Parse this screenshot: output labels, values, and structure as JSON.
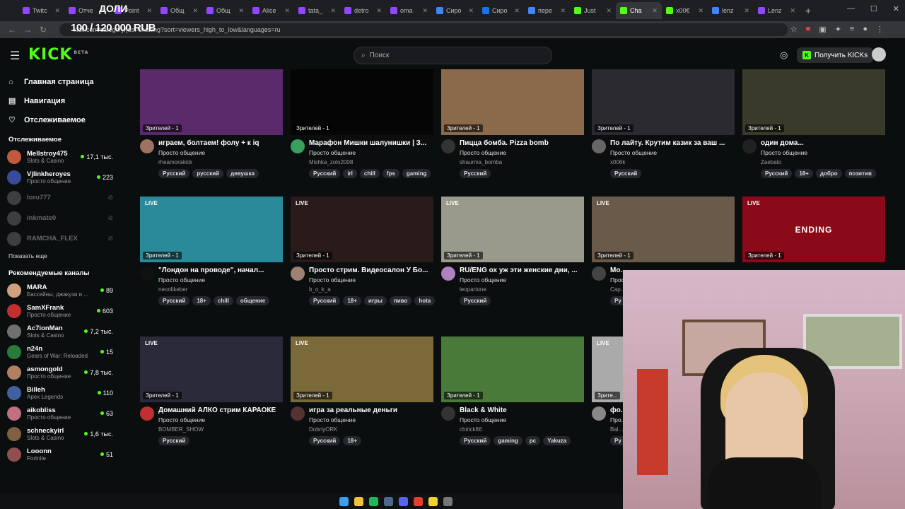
{
  "browser": {
    "tabs": [
      {
        "label": "Twitc",
        "color": "#9146ff"
      },
      {
        "label": "Отче",
        "color": "#9146ff"
      },
      {
        "label": "Point",
        "color": "#9146ff"
      },
      {
        "label": "Общ",
        "color": "#9146ff"
      },
      {
        "label": "Общ",
        "color": "#9146ff"
      },
      {
        "label": "Alice",
        "color": "#9146ff"
      },
      {
        "label": "tata_",
        "color": "#9146ff"
      },
      {
        "label": "detro",
        "color": "#9146ff"
      },
      {
        "label": "oma",
        "color": "#9146ff"
      },
      {
        "label": "Сиро",
        "color": "#4285f4"
      },
      {
        "label": "Сиро",
        "color": "#1a73e8"
      },
      {
        "label": "пере",
        "color": "#4285f4"
      },
      {
        "label": "Just",
        "color": "#53fc18"
      },
      {
        "label": "Сha",
        "color": "#53fc18"
      },
      {
        "label": "x00€",
        "color": "#53fc18"
      },
      {
        "label": "lenz",
        "color": "#4285f4"
      },
      {
        "label": "Lenz",
        "color": "#9146ff"
      }
    ],
    "active_tab_index": 13,
    "url": "kick.com/category/just-chatting?sort=viewers_high_to_low&languages=ru",
    "overlay_counter": "100 / 120 000 RUB",
    "overlay_label": "ДОЛИ"
  },
  "header": {
    "logo": "KICK",
    "logo_badge": "BETA",
    "search_placeholder": "Поиск",
    "get_kicks_label": "Получить KICKs"
  },
  "sidebar": {
    "nav": [
      {
        "label": "Главная страница",
        "icon": "home-icon",
        "glyph": "⌂"
      },
      {
        "label": "Навигация",
        "icon": "compass-icon",
        "glyph": "▤"
      },
      {
        "label": "Отслеживаемое",
        "icon": "heart-icon",
        "glyph": "♡"
      }
    ],
    "following_title": "Отслеживаемое",
    "following": [
      {
        "name": "Mellstroy475",
        "category": "Slots & Casino",
        "count": "17,1 тыс.",
        "online": true,
        "color": "#c05a3a"
      },
      {
        "name": "Vjlinkheroyes",
        "category": "Просто общение",
        "count": "223",
        "online": true,
        "color": "#3a4a9a"
      },
      {
        "name": "loru777",
        "category": "",
        "count": "",
        "online": false,
        "color": "#888"
      },
      {
        "name": "inkmate0",
        "category": "",
        "count": "",
        "online": false,
        "color": "#888"
      },
      {
        "name": "RAMCHA_FLEX",
        "category": "",
        "count": "",
        "online": false,
        "color": "#888"
      }
    ],
    "show_more": "Показать еще",
    "recommended_title": "Рекомендуемые каналы",
    "recommended": [
      {
        "name": "MARA",
        "category": "Бассейны, джакузи и ...",
        "count": "89",
        "color": "#d0a080"
      },
      {
        "name": "SamXFrank",
        "category": "Просто общение",
        "count": "603",
        "color": "#c03030"
      },
      {
        "name": "Ac7ionMan",
        "category": "Slots & Casino",
        "count": "7,2 тыс.",
        "color": "#707070"
      },
      {
        "name": "n24n",
        "category": "Gears of War: Reloaded",
        "count": "15",
        "color": "#2a7a3a"
      },
      {
        "name": "asmongold",
        "category": "Просто общение",
        "count": "7,8 тыс.",
        "color": "#b08060"
      },
      {
        "name": "Billeh",
        "category": "Apex Legends",
        "count": "110",
        "color": "#4060a0"
      },
      {
        "name": "aikobliss",
        "category": "Просто общение",
        "count": "63",
        "color": "#c07080"
      },
      {
        "name": "schneckyirl",
        "category": "Slots & Casino",
        "count": "1,6 тыс.",
        "color": "#806040"
      },
      {
        "name": "Looonn",
        "category": "Fortnite",
        "count": "51",
        "color": "#905050"
      }
    ]
  },
  "streams": [
    {
      "title": "играем, болтаем! фолу + к iq",
      "category": "Просто общение",
      "user": "rheamorakick",
      "viewers": "Зрителей - 1",
      "live": "",
      "tags": [
        "Русский",
        "русский",
        "девушка"
      ],
      "thumb": "#5a2a6a",
      "avatar": "#a07060"
    },
    {
      "title": "Марафон Мишки шалунишки | З...",
      "category": "Просто общение",
      "user": "Mishka_zolo2008",
      "viewers": "Зрителей - 1",
      "live": "",
      "tags": [
        "Русский",
        "irl",
        "chill",
        "fps",
        "gaming"
      ],
      "thumb": "#050505",
      "avatar": "#3aa060"
    },
    {
      "title": "Пицца бомба. Pizza bomb",
      "category": "Просто общение",
      "user": "shaurma_bomba",
      "viewers": "Зрителей - 1",
      "live": "",
      "tags": [
        "Русский"
      ],
      "thumb": "#8a6a4a",
      "avatar": "#333"
    },
    {
      "title": "По лайту. Крутим казик за ваш ...",
      "category": "Просто общение",
      "user": "x006k",
      "viewers": "Зрителей - 1",
      "live": "",
      "tags": [
        "Русский"
      ],
      "thumb": "#2a2a30",
      "avatar": "#666"
    },
    {
      "title": "один дома...",
      "category": "Просто общение",
      "user": "Zaebato",
      "viewers": "Зрителей - 1",
      "live": "",
      "tags": [
        "Русский",
        "18+",
        "добро",
        "позитив"
      ],
      "thumb": "#3a3a2a",
      "avatar": "#222"
    },
    {
      "title": "\"Лондон на проводе\", начал...",
      "category": "Просто общение",
      "user": "neonlikeber",
      "viewers": "Зрителей - 1",
      "live": "LIVE",
      "tags": [
        "Русский",
        "18+",
        "chill",
        "общение"
      ],
      "thumb": "#2a8a9a",
      "avatar": "#111"
    },
    {
      "title": "Просто стрим. Видеосалон У Бо...",
      "category": "Просто общение",
      "user": "b_o_k_a",
      "viewers": "Зрителей - 1",
      "live": "LIVE",
      "tags": [
        "Русский",
        "18+",
        "игры",
        "пиво",
        "hota"
      ],
      "thumb": "#2a1a1a",
      "avatar": "#a08070"
    },
    {
      "title": "RU/ENG ох уж эти женские дни, ...",
      "category": "Просто общение",
      "user": "leopartone",
      "viewers": "Зрителей - 1",
      "live": "LIVE",
      "tags": [
        "Русский"
      ],
      "thumb": "#9a9a8a",
      "avatar": "#b080c0"
    },
    {
      "title": "Мо...",
      "category": "Просто общение",
      "user": "Cap...",
      "viewers": "Зрителей - 1",
      "live": "LIVE",
      "tags": [
        "Ру"
      ],
      "thumb": "#6a5a4a",
      "avatar": "#444"
    },
    {
      "title": "",
      "category": "",
      "user": "",
      "viewers": "Зрителей - 1",
      "live": "LIVE",
      "tags": [],
      "thumb": "#8a0a1a",
      "avatar": "#333",
      "thumb_text": "ENDING"
    },
    {
      "title": "Домашний АЛКО стрим КАРАОКЕ",
      "category": "Просто общение",
      "user": "BOMBER_SHOW",
      "viewers": "Зрителей - 1",
      "live": "LIVE",
      "tags": [
        "Русский"
      ],
      "thumb": "#2a2a3a",
      "avatar": "#c03030"
    },
    {
      "title": "игра за реальные деньги",
      "category": "Просто общение",
      "user": "DobriyORK",
      "viewers": "Зрителей - 1",
      "live": "LIVE",
      "tags": [
        "Русский",
        "18+"
      ],
      "thumb": "#7a6a3a",
      "avatar": "#553333"
    },
    {
      "title": "Black & White",
      "category": "Просто общение",
      "user": "chirick86",
      "viewers": "Зрителей - 1",
      "live": "",
      "tags": [
        "Русский",
        "gaming",
        "pc",
        "Yakuza"
      ],
      "thumb": "#4a7a3a",
      "avatar": "#333"
    },
    {
      "title": "фо...",
      "category": "Про...",
      "user": "Bal...",
      "viewers": "Зрите...",
      "live": "LIVE",
      "tags": [
        "Ру"
      ],
      "thumb": "#aaa",
      "avatar": "#888"
    }
  ],
  "taskbar": {
    "icons": [
      {
        "name": "windows-start-icon",
        "color": "#3b9ff0"
      },
      {
        "name": "file-explorer-icon",
        "color": "#f0c040"
      },
      {
        "name": "spotify-icon",
        "color": "#1db954"
      },
      {
        "name": "steam-icon",
        "color": "#4a6a8a"
      },
      {
        "name": "discord-icon",
        "color": "#5865f2"
      },
      {
        "name": "chrome-icon",
        "color": "#e04030"
      },
      {
        "name": "notes-icon",
        "color": "#f0d030"
      },
      {
        "name": "obs-icon",
        "color": "#777"
      }
    ]
  },
  "colors": {
    "brand": "#53fc18",
    "background": "#0b0e0f"
  }
}
